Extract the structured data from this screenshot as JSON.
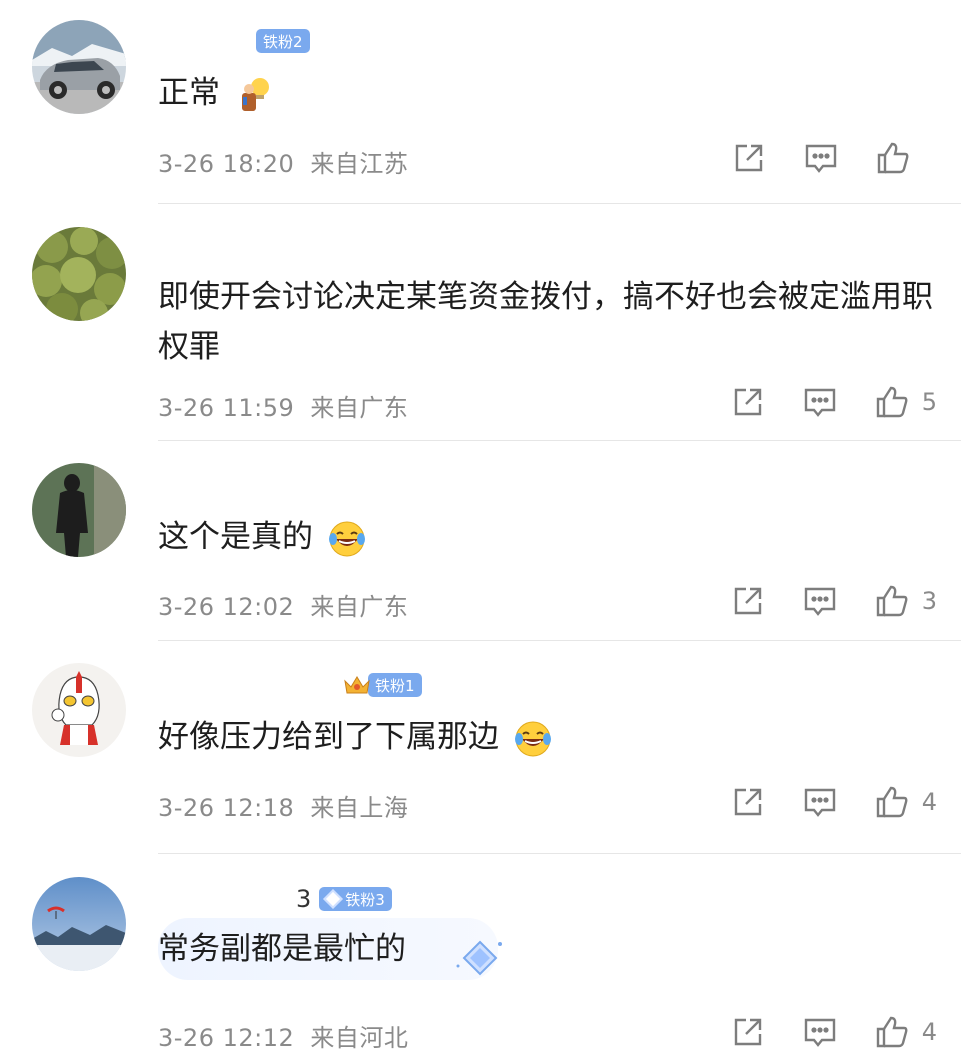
{
  "comments": [
    {
      "id": "c1",
      "badge": "铁粉2",
      "text": "正常",
      "emoji": "figure-with-lightbulb-emoji",
      "date": "3-26 18:20",
      "location": "来自江苏",
      "likes": "",
      "avatar": "car-avatar"
    },
    {
      "id": "c2",
      "badge": "",
      "text": "即使开会讨论决定某笔资金拨付，搞不好也会被定滥用职权罪",
      "emoji": "",
      "date": "3-26 11:59",
      "location": "来自广东",
      "likes": "5",
      "avatar": "cactus-avatar"
    },
    {
      "id": "c3",
      "badge": "",
      "text": "这个是真的",
      "emoji": "laughing-tears-emoji",
      "date": "3-26 12:02",
      "location": "来自广东",
      "likes": "3",
      "avatar": "silhouette-avatar"
    },
    {
      "id": "c4",
      "badge": "铁粉1",
      "text": "好像压力给到了下属那边",
      "emoji": "laughing-tears-emoji",
      "date": "3-26 12:18",
      "location": "来自上海",
      "likes": "4",
      "avatar": "ultraman-avatar"
    },
    {
      "id": "c5",
      "name_suffix": "3",
      "badge": "铁粉3",
      "text": "常务副都是最忙的",
      "emoji": "",
      "date": "3-26 12:12",
      "location": "来自河北",
      "likes": "4",
      "avatar": "paraglider-avatar"
    }
  ],
  "colors": {
    "badge": "#7aa9ee",
    "meta": "#8a8a8a",
    "divider": "#e6e6e6",
    "icon": "#7d7d7d"
  },
  "icons": [
    "share-icon",
    "comment-icon",
    "like-icon"
  ]
}
